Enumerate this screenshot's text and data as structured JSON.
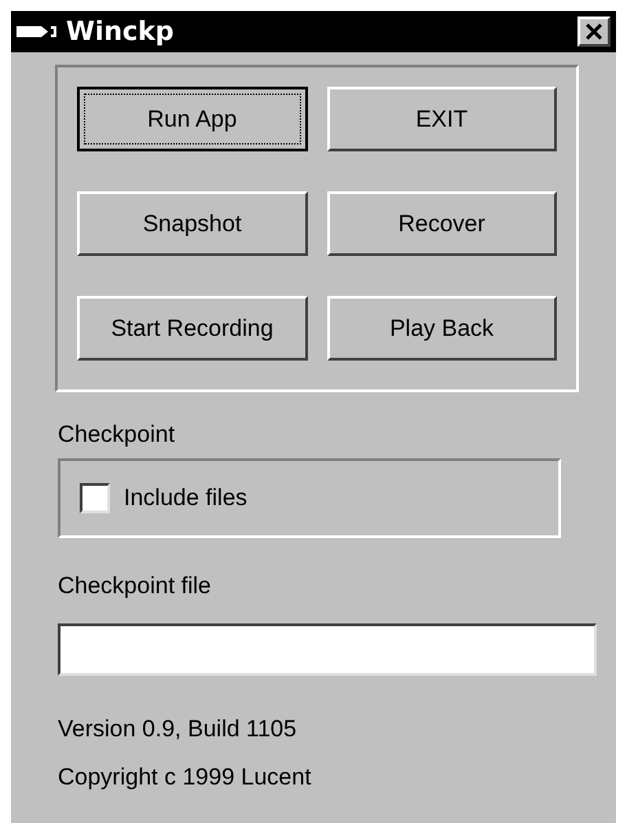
{
  "window": {
    "title": "Winckp"
  },
  "buttons": [
    {
      "label": "Run App",
      "focused": true
    },
    {
      "label": "EXIT",
      "focused": false
    },
    {
      "label": "Snapshot",
      "focused": false
    },
    {
      "label": "Recover",
      "focused": false
    },
    {
      "label": "Start Recording",
      "focused": false
    },
    {
      "label": "Play Back",
      "focused": false
    }
  ],
  "checkpoint_group": {
    "title": "Checkpoint",
    "checkbox": {
      "label": "Include files",
      "checked": false
    }
  },
  "checkpoint_file": {
    "label": "Checkpoint file"
  },
  "version": "Version 0.9, Build 1105",
  "copyright": "Copyright c 1999 Lucent"
}
